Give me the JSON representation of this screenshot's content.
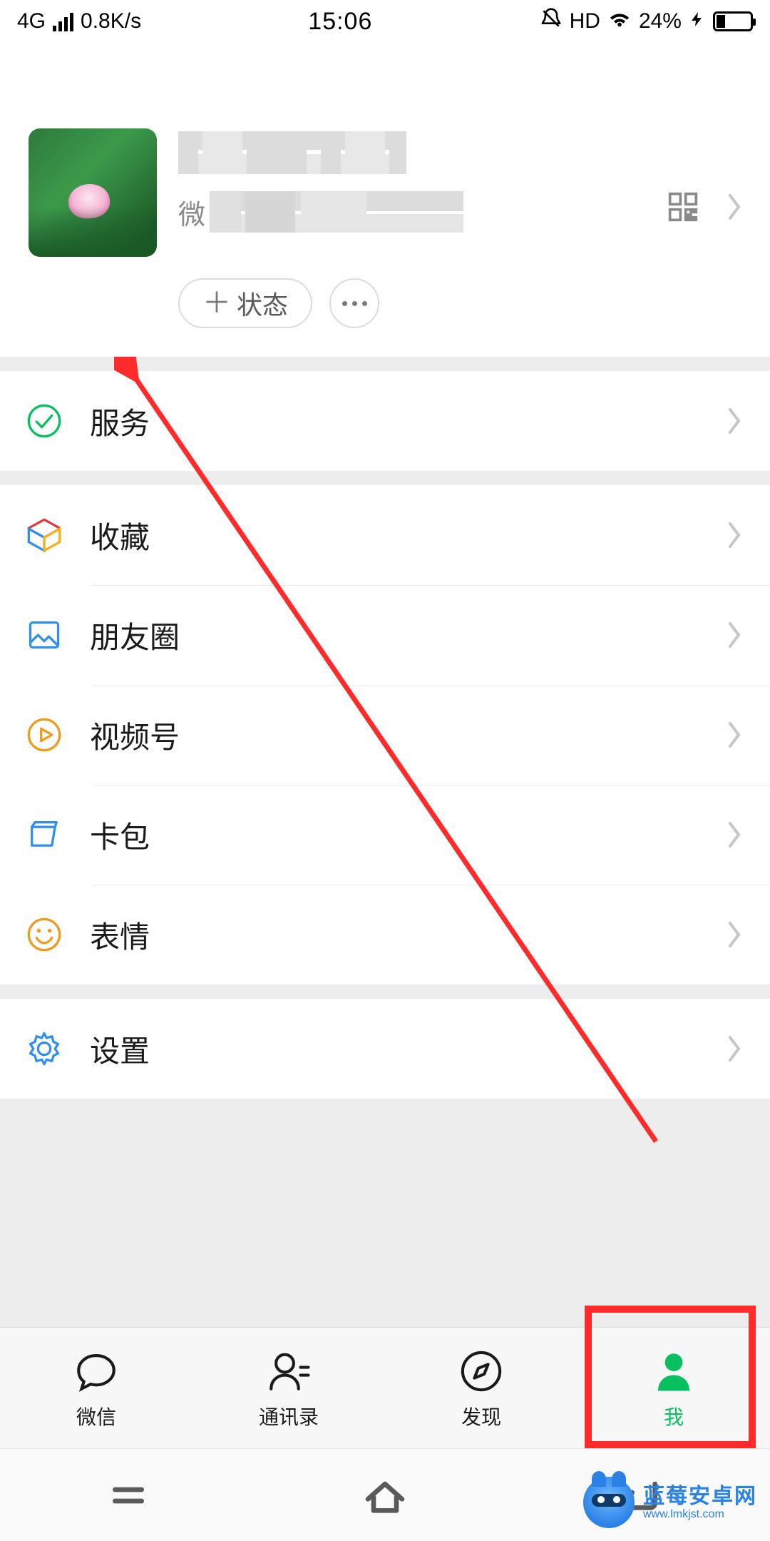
{
  "status_bar": {
    "network_type": "4G",
    "speed": "0.8K/s",
    "time": "15:06",
    "hd": "HD",
    "battery_percent": "24%"
  },
  "profile": {
    "wechat_id_prefix": "微",
    "status_button": "状态"
  },
  "sections": [
    {
      "items": [
        {
          "key": "services",
          "label": "服务",
          "icon": "service-icon"
        }
      ]
    },
    {
      "items": [
        {
          "key": "favorites",
          "label": "收藏",
          "icon": "cube-icon"
        },
        {
          "key": "moments",
          "label": "朋友圈",
          "icon": "image-icon"
        },
        {
          "key": "channels",
          "label": "视频号",
          "icon": "play-icon"
        },
        {
          "key": "cards",
          "label": "卡包",
          "icon": "wallet-icon"
        },
        {
          "key": "stickers",
          "label": "表情",
          "icon": "smile-icon"
        }
      ]
    },
    {
      "items": [
        {
          "key": "settings",
          "label": "设置",
          "icon": "gear-icon"
        }
      ]
    }
  ],
  "tabs": [
    {
      "key": "chats",
      "label": "微信"
    },
    {
      "key": "contacts",
      "label": "通讯录"
    },
    {
      "key": "discover",
      "label": "发现"
    },
    {
      "key": "me",
      "label": "我",
      "active": true
    }
  ],
  "watermark": {
    "line1": "蓝莓安卓网",
    "line2": "www.lmkjst.com"
  },
  "colors": {
    "accent": "#07c160",
    "annotation": "#ff2b2b",
    "watermark": "#2b82e6"
  }
}
